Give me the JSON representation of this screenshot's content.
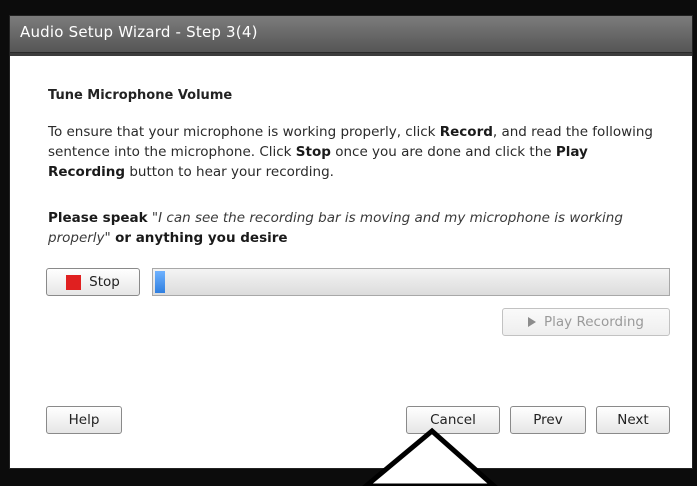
{
  "window": {
    "title": "Audio Setup Wizard - Step 3(4)"
  },
  "main": {
    "heading": "Tune Microphone Volume",
    "instructions": {
      "part1": "To ensure that your microphone is working properly, click ",
      "record": "Record",
      "part2": ", and read the following sentence into the microphone. Click ",
      "stop": "Stop",
      "part3": " once you are done and click the ",
      "play": "Play Recording",
      "part4": " button to hear your recording."
    },
    "speak": {
      "prefix": "Please speak",
      "quote": "\"I can see the recording bar is moving and my microphone is working properly\"",
      "suffix": "or anything you desire"
    }
  },
  "controls": {
    "stop_label": "Stop",
    "level_percent": 2,
    "play_label": "Play Recording"
  },
  "footer": {
    "help_label": "Help",
    "cancel_label": "Cancel",
    "prev_label": "Prev",
    "next_label": "Next"
  },
  "colors": {
    "stop_icon": "#e02020",
    "meter_fill": "#3a8ef0",
    "titlebar": "#6a6a6a"
  },
  "icons": {
    "stop": "stop-square-icon",
    "play": "play-triangle-icon"
  }
}
